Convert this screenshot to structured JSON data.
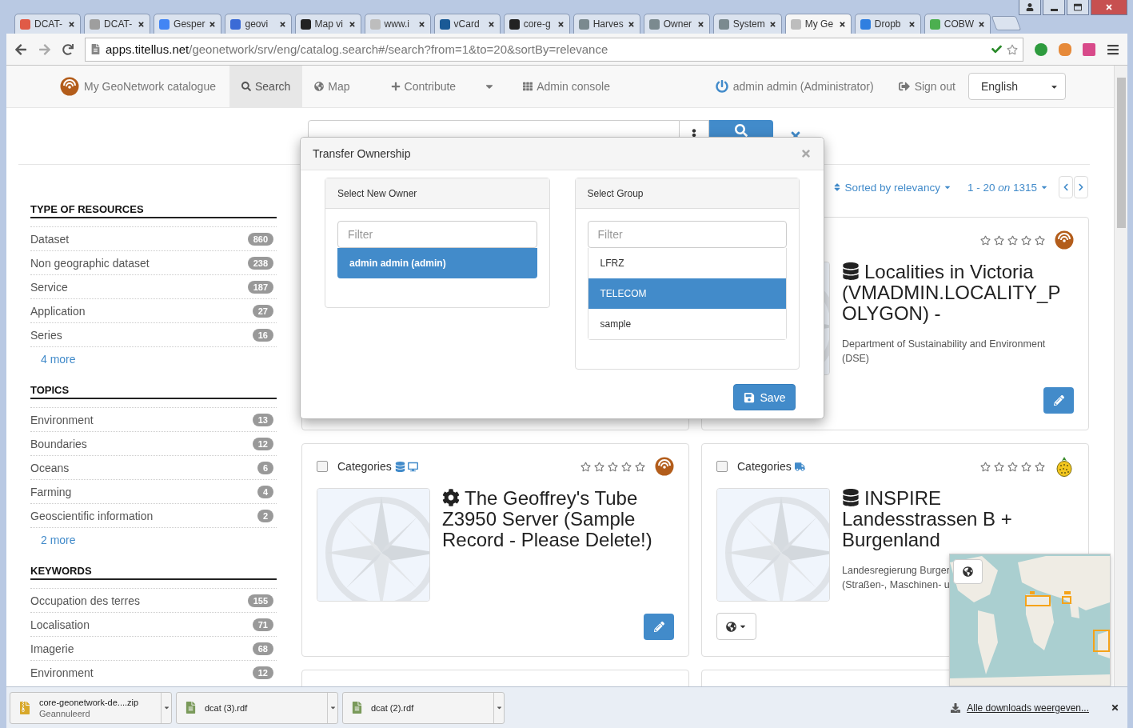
{
  "browser": {
    "tabs": [
      {
        "label": "DCAT-",
        "color": "#e05a47",
        "selected": false
      },
      {
        "label": "DCAT-",
        "color": "#9e9e9e",
        "selected": false
      },
      {
        "label": "Gesper",
        "color": "#4285f4",
        "selected": false
      },
      {
        "label": "geovi",
        "color": "#3b6bd6",
        "selected": false
      },
      {
        "label": "Map vi",
        "color": "#222222",
        "selected": false
      },
      {
        "label": "www.i",
        "color": "#bdbdbd",
        "selected": false
      },
      {
        "label": "vCard",
        "color": "#1a5a96",
        "selected": false
      },
      {
        "label": "core-g",
        "color": "#222222",
        "selected": false
      },
      {
        "label": "Harves",
        "color": "#7b8a8f",
        "selected": false
      },
      {
        "label": "Owner",
        "color": "#7b8a8f",
        "selected": false
      },
      {
        "label": "System",
        "color": "#7b8a8f",
        "selected": false
      },
      {
        "label": "My Ge",
        "color": "#bdbdbd",
        "selected": true
      },
      {
        "label": "Dropb",
        "color": "#2f7fe0",
        "selected": false
      },
      {
        "label": "COBW",
        "color": "#4caf50",
        "selected": false
      }
    ],
    "address": {
      "host": "apps.titellus.net",
      "path": "/geonetwork/srv/eng/catalog.search#/search?from=1&to=20&sortBy=relevance"
    }
  },
  "nav": {
    "brand": "My GeoNetwork catalogue",
    "items": [
      {
        "label": "Search",
        "selected": true,
        "has_menu": false
      },
      {
        "label": "Map",
        "selected": false,
        "has_menu": false
      },
      {
        "label": "Contribute",
        "selected": false,
        "has_menu": true
      },
      {
        "label": "Admin console",
        "selected": false,
        "has_menu": false
      }
    ],
    "user": "admin admin (Administrator)",
    "sign_out": "Sign out",
    "language": "English"
  },
  "facets": [
    {
      "title": "TYPE OF RESOURCES",
      "more": "4 more",
      "items": [
        {
          "label": "Dataset",
          "count": "860"
        },
        {
          "label": "Non geographic dataset",
          "count": "238"
        },
        {
          "label": "Service",
          "count": "187"
        },
        {
          "label": "Application",
          "count": "27"
        },
        {
          "label": "Series",
          "count": "16"
        }
      ]
    },
    {
      "title": "TOPICS",
      "more": "2 more",
      "items": [
        {
          "label": "Environment",
          "count": "13"
        },
        {
          "label": "Boundaries",
          "count": "12"
        },
        {
          "label": "Oceans",
          "count": "6"
        },
        {
          "label": "Farming",
          "count": "4"
        },
        {
          "label": "Geoscientific information",
          "count": "2"
        }
      ]
    },
    {
      "title": "KEYWORDS",
      "items": [
        {
          "label": "Occupation des terres",
          "count": "155"
        },
        {
          "label": "Localisation",
          "count": "71"
        },
        {
          "label": "Imagerie",
          "count": "68"
        },
        {
          "label": "Environment",
          "count": "12"
        }
      ]
    }
  ],
  "results": {
    "sort": "Sorted by relevancy",
    "range": "1 - 20 *on* 1315",
    "cards": [
      {
        "kind": "covered"
      },
      {
        "kind": "record",
        "stars": 0,
        "title": "Localities in Victoria (VMADMIN.LOCALITY_POLYGON) -",
        "description_lines": [
          "Department of Sustainability and Environment",
          "(DSE)"
        ]
      },
      {
        "kind": "record",
        "checked": false,
        "categories": "Categories",
        "stars": 0,
        "title": "The Geoffrey's Tube Z3950 Server (Sample Record - Please Delete!)"
      },
      {
        "kind": "record",
        "checked": false,
        "categories": "Categories",
        "stars": 0,
        "title": "INSPIRE Landesstrassen B + Burgenland",
        "description_lines": [
          "Landesregierung Burger",
          "(Straßen-, Maschinen- u"
        ],
        "map_open": true
      },
      {
        "kind": "covered"
      },
      {
        "kind": "covered"
      }
    ]
  },
  "modal": {
    "title": "Transfer Ownership",
    "save": "Save",
    "panels": [
      {
        "title": "Select New Owner",
        "placeholder": "Filter",
        "items": [
          {
            "label": "admin admin (admin)",
            "selected": true
          }
        ]
      },
      {
        "title": "Select Group",
        "placeholder": "Filter",
        "items": [
          {
            "label": "LFRZ",
            "selected": false
          },
          {
            "label": "TELECOM",
            "selected": true
          },
          {
            "label": "sample",
            "selected": false
          }
        ]
      }
    ]
  },
  "downloads": {
    "items": [
      {
        "name": "core-geonetwork-de....zip",
        "status": "Geannuleerd",
        "kind": "archive"
      },
      {
        "name": "dcat (3).rdf",
        "kind": "document"
      },
      {
        "name": "dcat (2).rdf",
        "kind": "document"
      }
    ],
    "show_all": "Alle downloads weergeven..."
  }
}
